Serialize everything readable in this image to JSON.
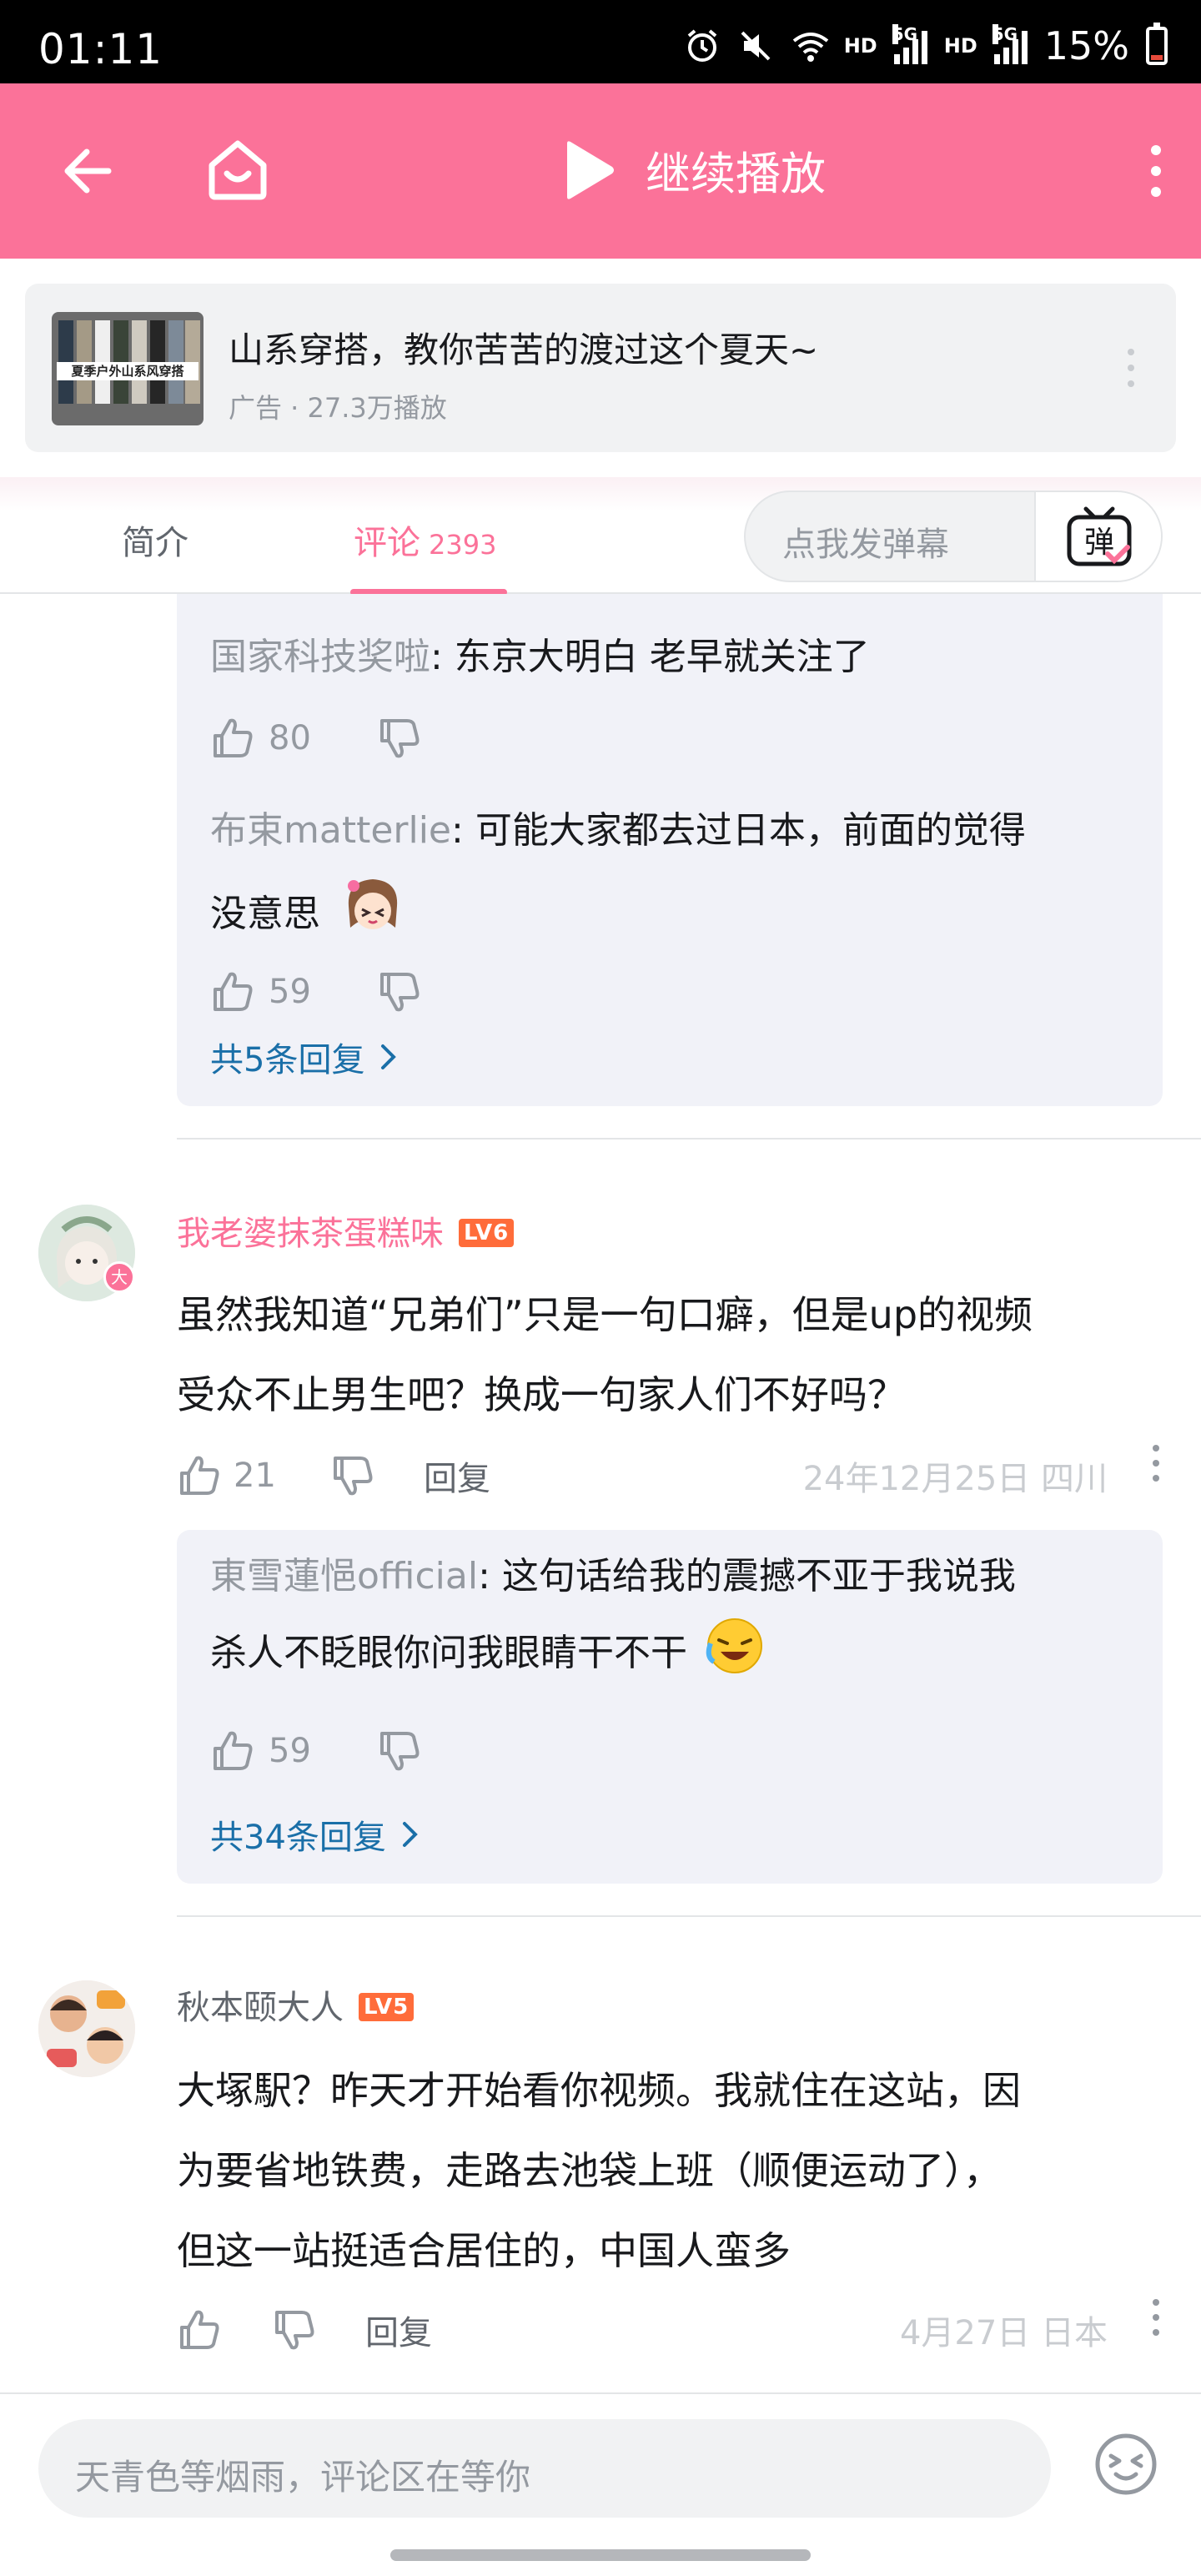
{
  "status_bar": {
    "time": "01:11",
    "network_1": "HD",
    "gen_1": "5G",
    "network_2": "HD",
    "gen_2": "5G",
    "battery": "15%"
  },
  "header": {
    "continue_label": "继续播放",
    "icons": [
      "back-arrow-icon",
      "home-icon",
      "play-icon",
      "more-vertical-icon"
    ],
    "color": "#fb7299"
  },
  "ad": {
    "thumb_text": "夏季户外山系风穿搭",
    "title": "山系穿搭，教你苦苦的渡过这个夏天~",
    "meta": "广告 · 27.3万播放"
  },
  "tabs": {
    "intro": "简介",
    "comments": "评论",
    "comment_count": "2393",
    "danmaku_placeholder": "点我发弹幕",
    "danmaku_icon_label": "弹"
  },
  "thread1": {
    "replies": [
      {
        "user": "国家科技奖啦",
        "text": ": 东京大明白 老早就关注了",
        "likes": "80"
      },
      {
        "user": "布束matterlie",
        "text_line1": ": 可能大家都去过日本，前面的觉得",
        "text_line2": "没意思",
        "likes": "59"
      }
    ],
    "more_replies": "共5条回复"
  },
  "comment2": {
    "user": "我老婆抹茶蛋糕味",
    "level": "LV6",
    "avatar_badge": "大",
    "line1": "虽然我知道“兄弟们”只是一句口癖，但是up的视频",
    "line2": "受众不止男生吧？换成一句家人们不好吗？",
    "likes": "21",
    "reply_label": "回复",
    "date_location": "24年12月25日 四川",
    "reply": {
      "user": "東雪蓮悒official",
      "line1": ": 这句话给我的震撼不亚于我说我",
      "line2": "杀人不眨眼你问我眼睛干不干",
      "likes": "59"
    },
    "more_replies": "共34条回复"
  },
  "comment3": {
    "user": "秋本颐大人",
    "level": "LV5",
    "line1": "大塚駅？昨天才开始看你视频。我就住在这站，因",
    "line2": "为要省地铁费，走路去池袋上班（顺便运动了），",
    "line3": "但这一站挺适合居住的，中国人蛮多",
    "reply_label": "回复",
    "date_location": "4月27日 日本"
  },
  "bottom": {
    "placeholder": "天青色等烟雨，评论区在等你"
  }
}
